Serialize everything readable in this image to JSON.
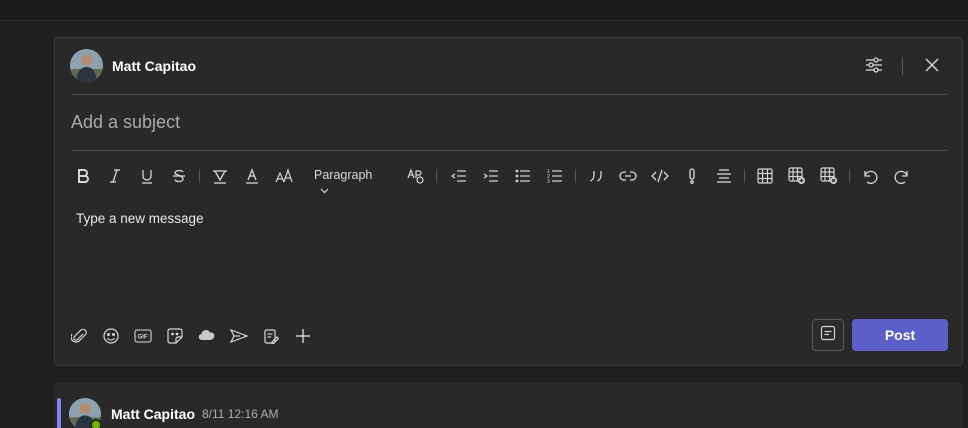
{
  "compose": {
    "author_name": "Matt Capitao",
    "subject_placeholder": "Add a subject",
    "message_placeholder": "Type a new message",
    "paragraph_style": "Paragraph",
    "post_label": "Post",
    "header_icons": [
      "format-options-icon",
      "close-icon"
    ],
    "toolbar_icons": [
      "bold-icon",
      "italic-icon",
      "underline-icon",
      "strikethrough-icon",
      "highlight-icon",
      "font-color-icon",
      "font-size-icon",
      "paragraph-dropdown",
      "clear-formatting-icon",
      "decrease-indent-icon",
      "increase-indent-icon",
      "bulleted-list-icon",
      "numbered-list-icon",
      "quote-icon",
      "link-icon",
      "code-snippet-icon",
      "important-icon",
      "align-icon",
      "table-icon",
      "insert-table-row-icon",
      "delete-table-icon",
      "undo-icon",
      "redo-icon"
    ],
    "bottom_icons": [
      "attach-icon",
      "emoji-icon",
      "gif-icon",
      "sticker-icon",
      "loop-icon",
      "send-later-icon",
      "praise-icon",
      "add-icon"
    ]
  },
  "thread": {
    "author_name": "Matt Capitao",
    "timestamp": "8/11 12:16 AM"
  },
  "colors": {
    "background": "#1f1f1f",
    "card": "#292929",
    "accent": "#5b5fc7",
    "thread_accent": "#7f85f5",
    "presence": "#6bb700"
  }
}
